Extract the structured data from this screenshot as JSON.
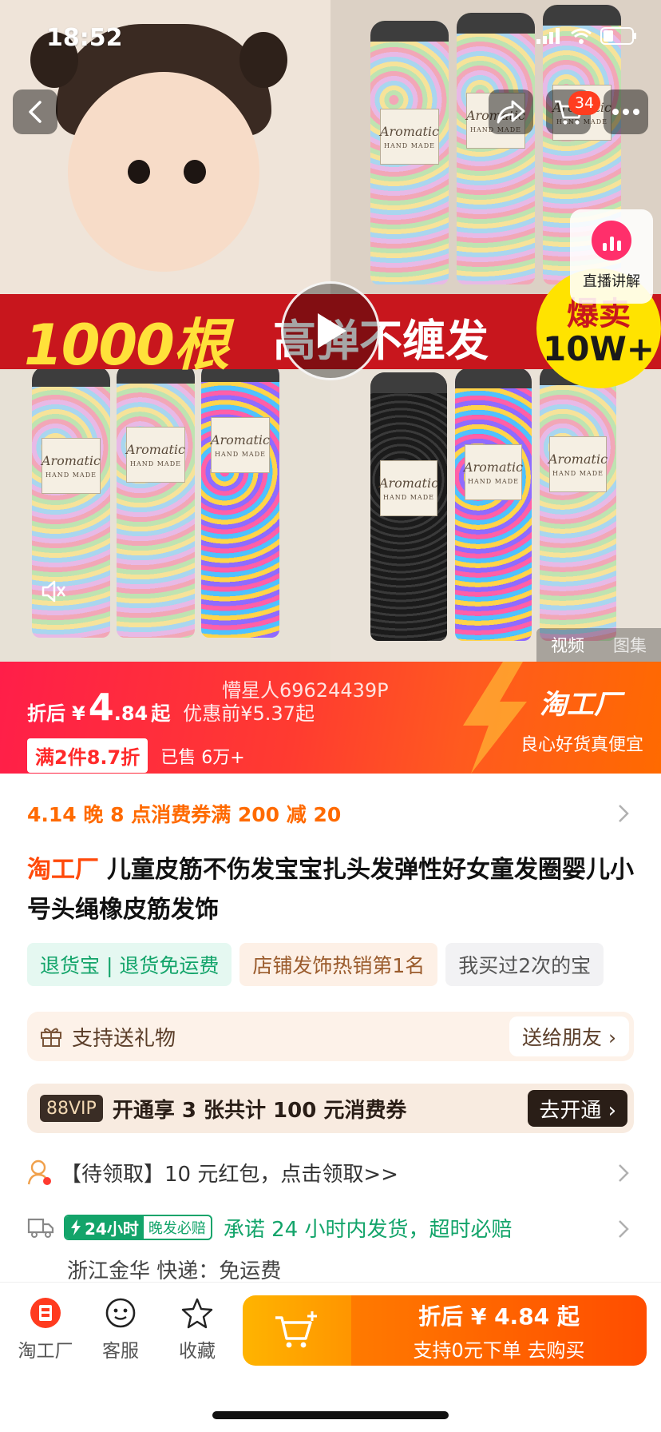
{
  "status_bar": {
    "time": "18:52"
  },
  "top_nav": {
    "cart_count": "34"
  },
  "media": {
    "banner_count": "1000根",
    "banner_slogan": "高弹不缠发",
    "burst_line1": "爆卖",
    "burst_line2": "10W+",
    "jar_label": "Aromatic",
    "jar_sublabel": "HAND MADE",
    "live_label": "直播讲解",
    "tabs": [
      {
        "label": "视频",
        "active": true
      },
      {
        "label": "图集",
        "active": false
      }
    ]
  },
  "price": {
    "watermark": "懵星人69624439P",
    "prefix": "折后",
    "currency": "¥",
    "integer": "4",
    "decimal": ".84",
    "suffix": "起",
    "before_discount": "优惠前¥5.37起",
    "promo": "满2件8.7折",
    "sold": "已售 6万+",
    "brand": "淘工厂",
    "slogan": "良心好货真便宜"
  },
  "coupon": {
    "text": "4.14 晚 8 点消费券满 200 减 20"
  },
  "title": {
    "brand": "淘工厂",
    "text": "儿童皮筋不伤发宝宝扎头发弹性好女童发圈婴儿小号头绳橡皮筋发饰"
  },
  "tags": [
    {
      "label": "退货宝 | 退货免运费",
      "style": "green"
    },
    {
      "label": "店铺发饰热销第1名",
      "style": "orange"
    },
    {
      "label": "我买过2次的宝",
      "style": "gray"
    }
  ],
  "gift": {
    "label": "支持送礼物",
    "button": "送给朋友 ›"
  },
  "vip": {
    "badge": "88VIP",
    "text": "开通享 3 张共计 100 元消费券",
    "button": "去开通 ›"
  },
  "red_packet": {
    "text": "【待领取】10 元红包，点击领取>>"
  },
  "shipping": {
    "badge_main": "24小时",
    "badge_sub": "晚发必赔",
    "promise": "承诺 24 小时内发货，超时必赔",
    "location": "浙江金华  快递：免运费"
  },
  "bottom_bar": {
    "items": [
      {
        "label": "淘工厂"
      },
      {
        "label": "客服"
      },
      {
        "label": "收藏"
      }
    ],
    "buy_line1": "折后 ¥ 4.84 起",
    "buy_line2": "支持0元下单  去购买"
  },
  "colors": {
    "accent": "#ff4a0a",
    "price_band": "#ff2a3a",
    "green": "#13a46a",
    "vip_dark": "#2a1e17"
  }
}
